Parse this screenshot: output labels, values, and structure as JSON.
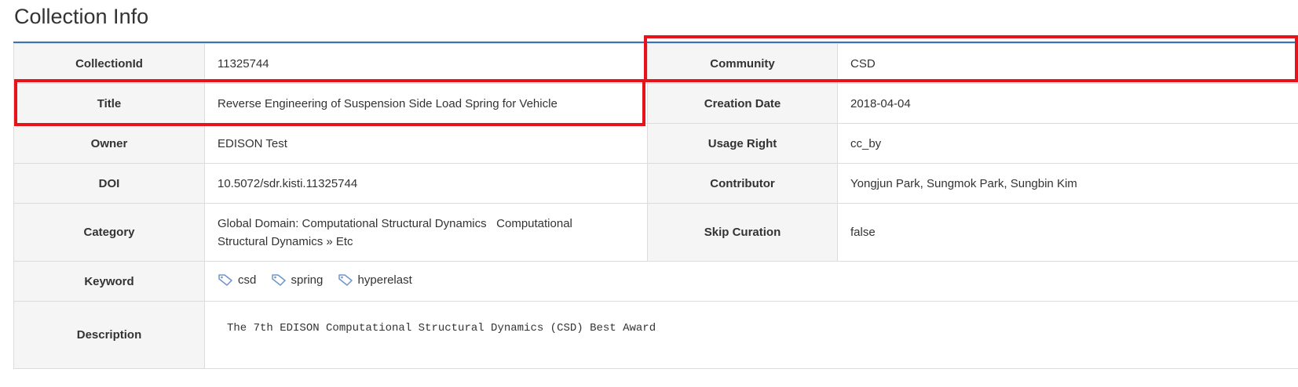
{
  "page_title": "Collection Info",
  "rows": {
    "collection_id": {
      "label": "CollectionId",
      "value": "11325744"
    },
    "community": {
      "label": "Community",
      "value": "CSD"
    },
    "title": {
      "label": "Title",
      "value": "Reverse Engineering of Suspension Side Load Spring for Vehicle"
    },
    "creation_date": {
      "label": "Creation Date",
      "value": "2018-04-04"
    },
    "owner": {
      "label": "Owner",
      "value": "EDISON Test"
    },
    "usage_right": {
      "label": "Usage Right",
      "value": "cc_by"
    },
    "doi": {
      "label": "DOI",
      "value": "10.5072/sdr.kisti.11325744"
    },
    "contributor": {
      "label": "Contributor",
      "value": "Yongjun Park, Sungmok Park, Sungbin Kim"
    },
    "category": {
      "label": "Category",
      "value_line1": "Global Domain: Computational Structural Dynamics   Computational",
      "value_line2": "Structural Dynamics » Etc"
    },
    "skip_curation": {
      "label": "Skip Curation",
      "value": "false"
    },
    "keyword": {
      "label": "Keyword",
      "tags": [
        "csd",
        "spring",
        "hyperelast"
      ]
    },
    "description": {
      "label": "Description",
      "value": "The 7th EDISON Computational Structural Dynamics (CSD) Best Award"
    }
  },
  "icons": {
    "tag": "tag-icon"
  },
  "colors": {
    "highlight": "#e8131a",
    "rule": "#3a72b5",
    "label_bg": "#f5f5f5",
    "tag_icon": "#6f95c8"
  }
}
